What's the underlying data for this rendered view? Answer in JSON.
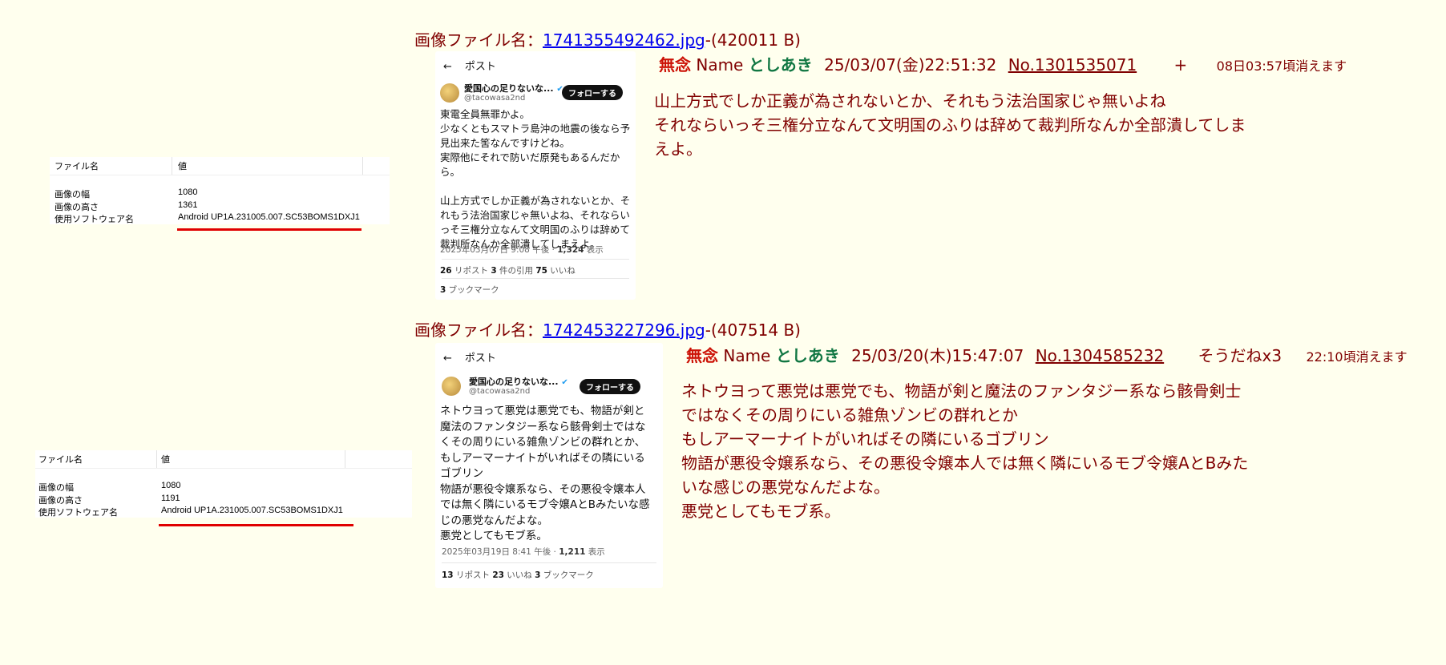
{
  "metadata_tables": [
    {
      "header_key": "ファイル名",
      "header_val": "値",
      "rows": [
        {
          "key": "画像の幅",
          "val": "1080"
        },
        {
          "key": "画像の高さ",
          "val": "1361"
        },
        {
          "key": "使用ソフトウェア名",
          "val": "Android UP1A.231005.007.SC53BOMS1DXJ1"
        }
      ]
    },
    {
      "header_key": "ファイル名",
      "header_val": "値",
      "rows": [
        {
          "key": "画像の幅",
          "val": "1080"
        },
        {
          "key": "画像の高さ",
          "val": "1191"
        },
        {
          "key": "使用ソフトウェア名",
          "val": "Android UP1A.231005.007.SC53BOMS1DXJ1"
        }
      ]
    }
  ],
  "posts": [
    {
      "file_label": "画像ファイル名：",
      "file_link": "1741355492462.jpg",
      "file_size": "-(420011 B)",
      "subject": "無念",
      "name_label": "Name",
      "name": "としあき",
      "date": "25/03/07(金)22:51:32",
      "number": "No.1301535071",
      "action": "+",
      "expire": "08日03:57頃消えます",
      "body": [
        "山上方式でしか正義が為されないとか、それもう法治国家じゃ無いよね",
        "それならいっそ三権分立なんて文明国のふりは辞めて裁判所なんか全部潰してしま",
        "えよ。"
      ],
      "thumb": {
        "back_arrow": "←",
        "header": "ポスト",
        "account": "愛国心の足りないな...",
        "verified": "✔",
        "handle": "@tacowasa2nd",
        "follow": "フォローする",
        "text": [
          "東電全員無罪かよ。",
          "少なくともスマトラ島沖の地震の後なら予",
          "見出来た筈なんですけどね。",
          "実際他にそれで防いだ原発もあるんだか",
          "ら。",
          "",
          "山上方式でしか正義が為されないとか、そ",
          "れもう法治国家じゃ無いよね、それならい",
          "っそ三権分立なんて文明国のふりは辞めて",
          "裁判所なんか全部潰してしまえよ。"
        ],
        "timestamp": "2025年03月07日 9:08 午後 · ",
        "views_num": "1,324",
        "views_label": " 表示",
        "stats_line1": [
          {
            "num": "26",
            "label": " リポスト  "
          },
          {
            "num": "3",
            "label": " 件の引用  "
          },
          {
            "num": "75",
            "label": " いいね"
          }
        ],
        "stats_line2": [
          {
            "num": "3",
            "label": " ブックマーク"
          }
        ]
      }
    },
    {
      "file_label": "画像ファイル名：",
      "file_link": "1742453227296.jpg",
      "file_size": "-(407514 B)",
      "subject": "無念",
      "name_label": "Name",
      "name": "としあき",
      "date": "25/03/20(木)15:47:07",
      "number": "No.1304585232",
      "action": "そうだねx3",
      "expire": "22:10頃消えます",
      "body": [
        "ネトウヨって悪党は悪党でも、物語が剣と魔法のファンタジー系なら骸骨剣士",
        "ではなくその周りにいる雑魚ゾンビの群れとか",
        "もしアーマーナイトがいればその隣にいるゴブリン",
        "物語が悪役令嬢系なら、その悪役令嬢本人では無く隣にいるモブ令嬢AとBみた",
        "いな感じの悪党なんだよな。",
        "悪党としてもモブ系。"
      ],
      "thumb": {
        "back_arrow": "←",
        "header": "ポスト",
        "account": "愛国心の足りないな...",
        "verified": "✔",
        "handle": "@tacowasa2nd",
        "follow": "フォローする",
        "text": [
          "ネトウヨって悪党は悪党でも、物語が剣と",
          "魔法のファンタジー系なら骸骨剣士ではな",
          "くその周りにいる雑魚ゾンビの群れとか、",
          "もしアーマーナイトがいればその隣にいる",
          "ゴブリン",
          "物語が悪役令嬢系なら、その悪役令嬢本人",
          "では無く隣にいるモブ令嬢AとBみたいな感",
          "じの悪党なんだよな。",
          "悪党としてもモブ系。"
        ],
        "timestamp": "2025年03月19日 8:41 午後 · ",
        "views_num": "1,211",
        "views_label": " 表示",
        "stats_line1": [
          {
            "num": "13",
            "label": " リポスト  "
          },
          {
            "num": "23",
            "label": " いいね  "
          },
          {
            "num": "3",
            "label": " ブックマーク"
          }
        ],
        "stats_line2": []
      }
    }
  ]
}
